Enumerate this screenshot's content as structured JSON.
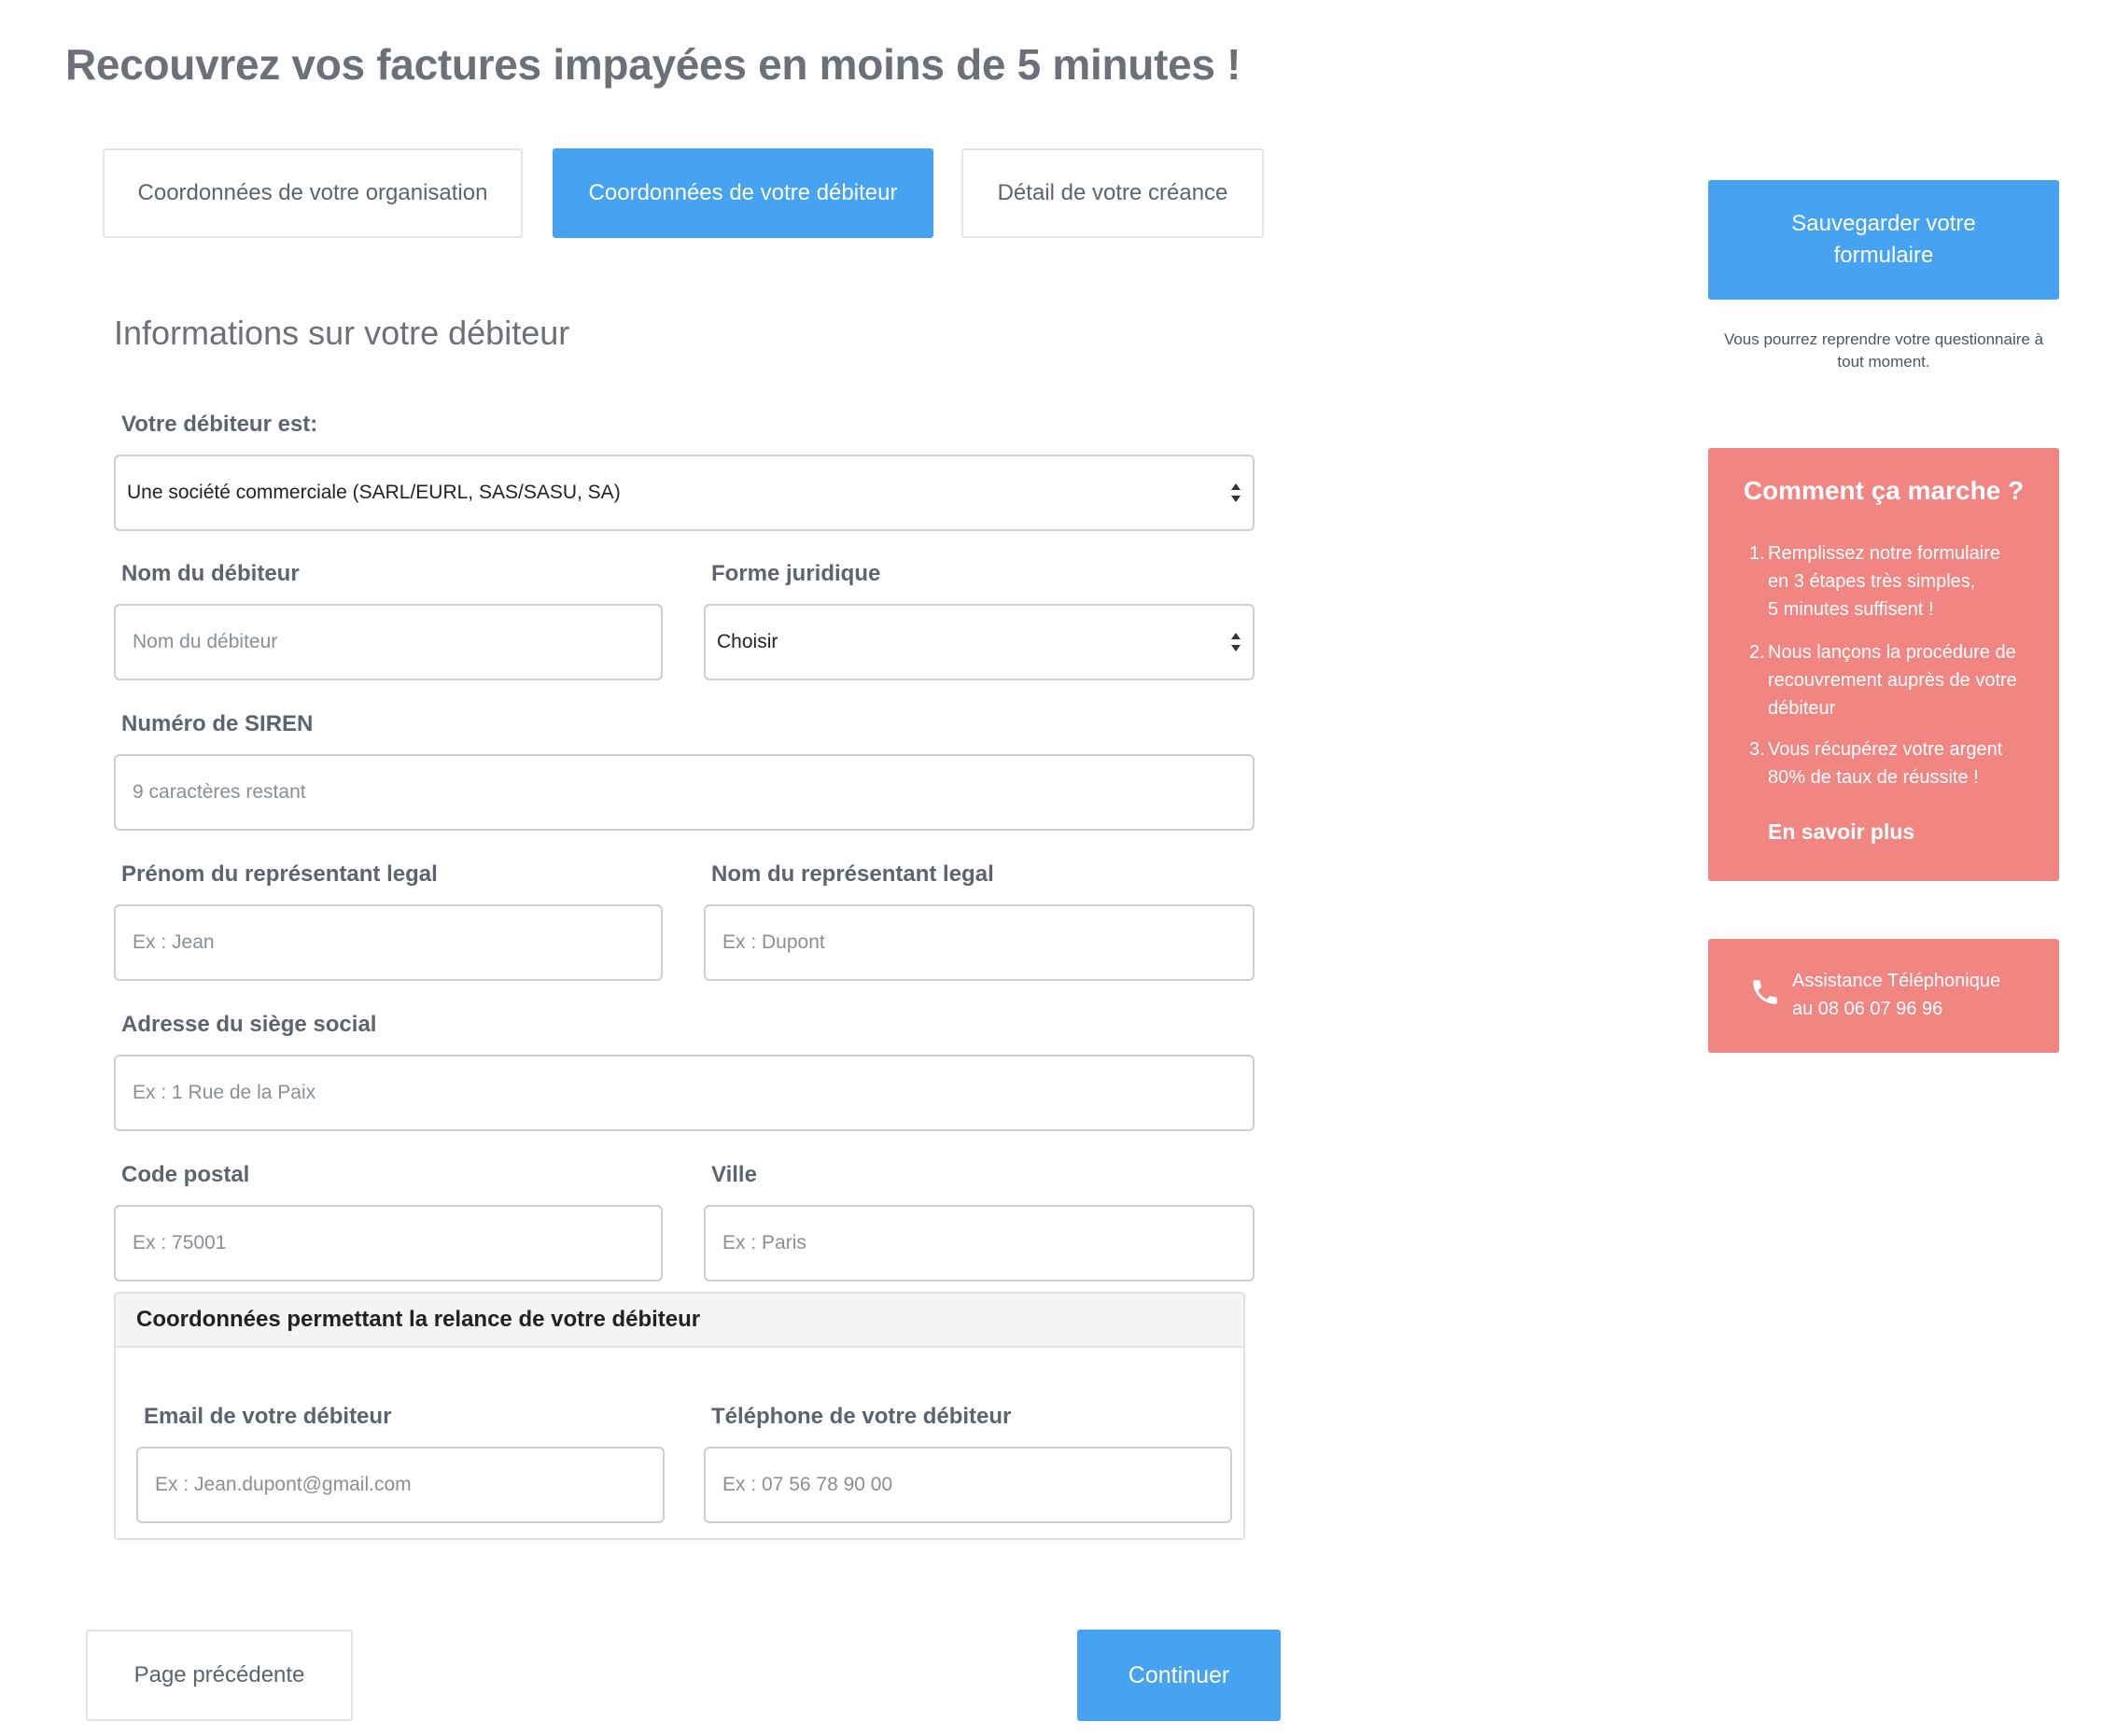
{
  "page": {
    "title": "Recouvrez vos factures impayées en moins de 5 minutes !"
  },
  "tabs": [
    {
      "label": "Coordonnées de votre organisation",
      "active": false
    },
    {
      "label": "Coordonnées de votre débiteur",
      "active": true
    },
    {
      "label": "Détail de votre créance",
      "active": false
    }
  ],
  "form": {
    "section_title": "Informations sur votre débiteur",
    "debtor_type": {
      "label": "Votre débiteur est:",
      "value": "Une société commerciale (SARL/EURL, SAS/SASU, SA)"
    },
    "debtor_name": {
      "label": "Nom du débiteur",
      "placeholder": "Nom du débiteur"
    },
    "legal_form": {
      "label": "Forme juridique",
      "value": "Choisir"
    },
    "siren": {
      "label": "Numéro de SIREN",
      "placeholder": "9 caractères restant"
    },
    "rep_firstname": {
      "label": "Prénom du représentant legal",
      "placeholder": "Ex : Jean"
    },
    "rep_lastname": {
      "label": "Nom du représentant legal",
      "placeholder": "Ex : Dupont"
    },
    "address": {
      "label": "Adresse du siège social",
      "placeholder": "Ex : 1 Rue de la Paix"
    },
    "postal_code": {
      "label": "Code postal",
      "placeholder": "Ex : 75001"
    },
    "city": {
      "label": "Ville",
      "placeholder": "Ex : Paris"
    },
    "contact_panel": {
      "title": "Coordonnées permettant la relance de votre débiteur",
      "email": {
        "label": "Email de votre débiteur",
        "placeholder": "Ex : Jean.dupont@gmail.com"
      },
      "phone": {
        "label": "Téléphone de votre débiteur",
        "placeholder": "Ex : 07 56 78 90 00"
      }
    }
  },
  "footer": {
    "previous_label": "Page précédente",
    "continue_label": "Continuer"
  },
  "sidebar": {
    "save_button": {
      "line1": "Sauvegarder votre",
      "line2": "formulaire"
    },
    "save_note": {
      "line1": "Vous pourrez reprendre votre questionnaire à",
      "line2": "tout moment."
    },
    "how_it_works": {
      "title": "Comment ça marche ?",
      "steps": [
        {
          "num": "1.",
          "lines": [
            "Remplissez notre formulaire",
            "en 3 étapes très simples,",
            "5 minutes suffisent !"
          ]
        },
        {
          "num": "2.",
          "lines": [
            "Nous lançons la procédure de",
            "recouvrement auprès de votre",
            "débiteur"
          ]
        },
        {
          "num": "3.",
          "lines": [
            "Vous récupérez votre argent",
            "80% de taux de réussite !"
          ]
        }
      ],
      "more_link": "En savoir plus"
    },
    "assistance": {
      "line1": "Assistance Téléphonique",
      "line2": "au 08 06 07 96 96",
      "icon": "phone-icon"
    }
  },
  "colors": {
    "primary": "#45a3f1",
    "accent": "#f08582",
    "text": "#5c6470"
  }
}
